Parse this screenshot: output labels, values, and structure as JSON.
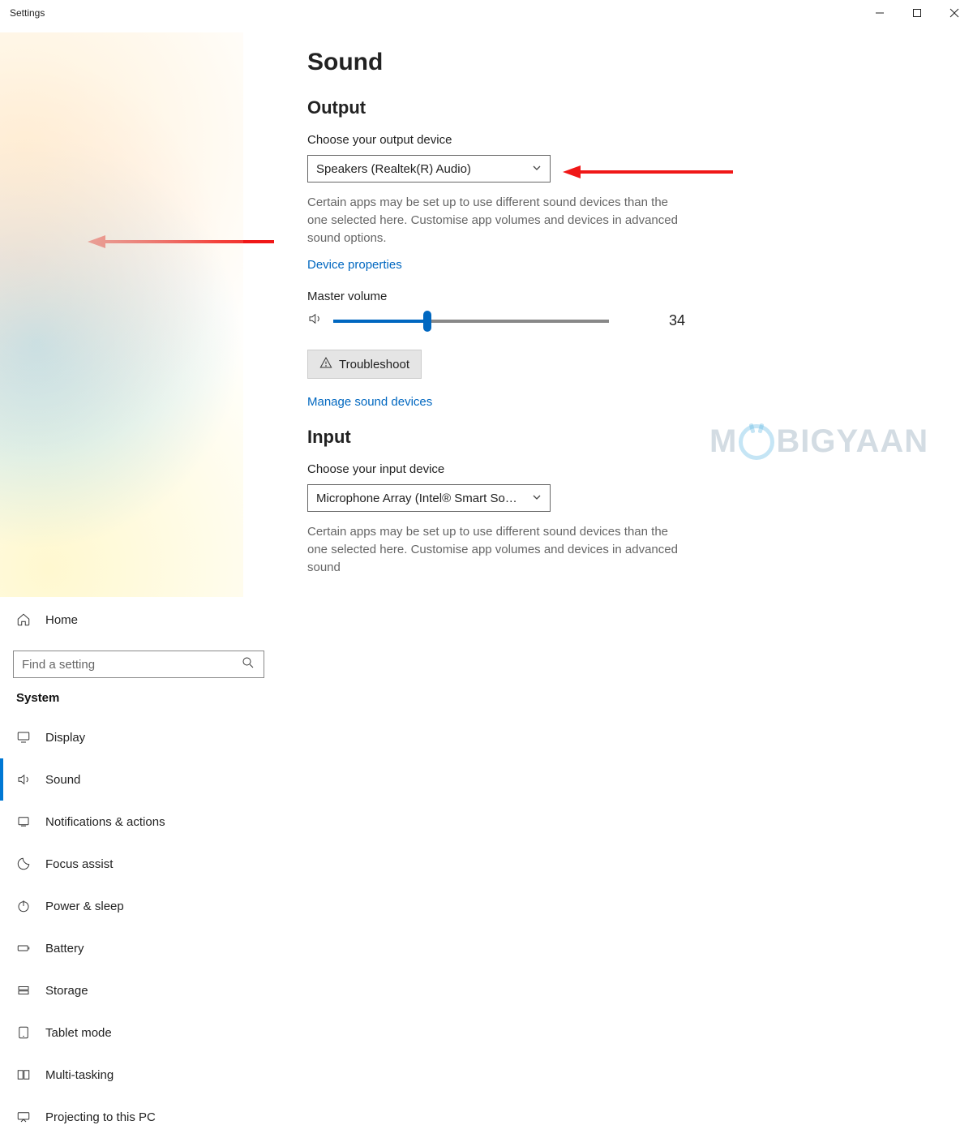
{
  "window": {
    "title": "Settings"
  },
  "sidebar": {
    "home": "Home",
    "search_placeholder": "Find a setting",
    "section": "System",
    "items": [
      {
        "label": "Display"
      },
      {
        "label": "Sound"
      },
      {
        "label": "Notifications & actions"
      },
      {
        "label": "Focus assist"
      },
      {
        "label": "Power & sleep"
      },
      {
        "label": "Battery"
      },
      {
        "label": "Storage"
      },
      {
        "label": "Tablet mode"
      },
      {
        "label": "Multi-tasking"
      },
      {
        "label": "Projecting to this PC"
      }
    ]
  },
  "main": {
    "title": "Sound",
    "output": {
      "heading": "Output",
      "choose_label": "Choose your output device",
      "device": "Speakers (Realtek(R) Audio)",
      "desc": "Certain apps may be set up to use different sound devices than the one selected here. Customise app volumes and devices in advanced sound options.",
      "device_props": "Device properties",
      "master_volume_label": "Master volume",
      "volume_value": "34",
      "troubleshoot": "Troubleshoot",
      "manage": "Manage sound devices"
    },
    "input": {
      "heading": "Input",
      "choose_label": "Choose your input device",
      "device": "Microphone Array (Intel® Smart So…",
      "desc": "Certain apps may be set up to use different sound devices than the one selected here. Customise app volumes and devices in advanced sound"
    }
  },
  "watermark": {
    "pre": "M",
    "post": "BIGYAAN"
  }
}
